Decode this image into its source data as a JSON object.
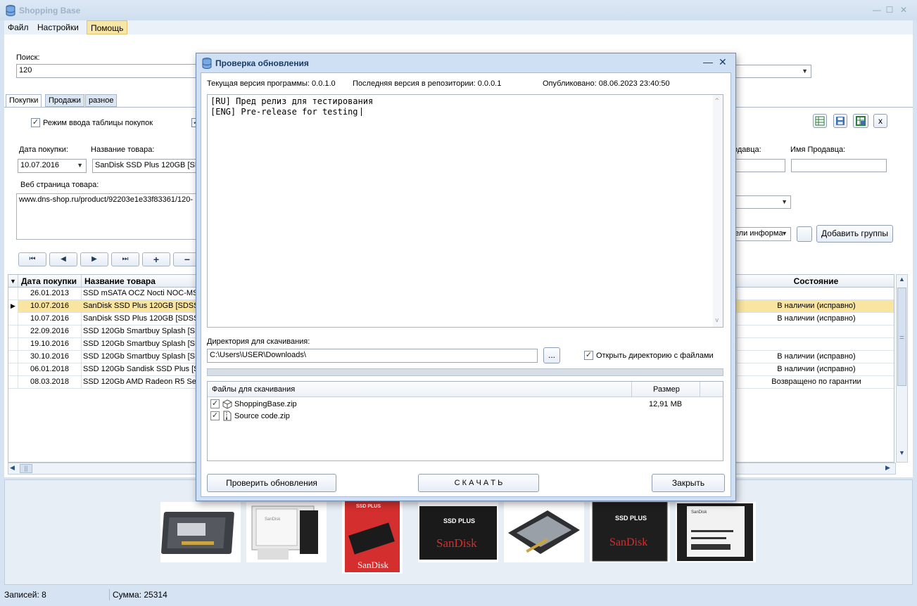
{
  "app": {
    "title": "Shopping Base"
  },
  "window_buttons": {
    "minimize": "—",
    "maximize": "☐",
    "close": "✕"
  },
  "menu": [
    "Файл",
    "Настройки",
    "Помощь"
  ],
  "search": {
    "label": "Поиск:",
    "value": "120"
  },
  "tabs": [
    "Покупки",
    "Продажи",
    "разное"
  ],
  "purchase_mode": {
    "label": "Режим ввода таблицы покупок",
    "checked": true
  },
  "fields": {
    "purchase_date_label": "Дата покупки:",
    "purchase_date_value": "10.07.2016",
    "product_name_label": "Название товара:",
    "product_name_value": "SanDisk SSD Plus 120GB [SDSS",
    "seller_label_partial": "одавца:",
    "seller_name_label": "Имя Продавца:",
    "web_page_label": "Веб страница товара:",
    "web_page_value": "www.dns-shop.ru/product/92203e1e33f83361/120-",
    "info_combo_value": "ели информа",
    "add_groups_button": "Добавить группы"
  },
  "toolbar_icons": [
    "excel-icon",
    "save-icon",
    "export-icon"
  ],
  "toolbar_close": "x",
  "nav_buttons": [
    "⏮",
    "◀",
    "▶",
    "⏭",
    "+",
    "−"
  ],
  "grid": {
    "headers": {
      "date": "Дата покупки",
      "name": "Название товара",
      "state": "Состояние"
    },
    "rows": [
      {
        "date": "26.01.2013",
        "name": "SSD mSATA OCZ Nocti NOC-MSAT",
        "state": "",
        "selected": false
      },
      {
        "date": "10.07.2016",
        "name": "SanDisk SSD Plus 120GB [SDSSDA",
        "state": "В наличии (исправно)",
        "selected": true
      },
      {
        "date": "10.07.2016",
        "name": "SanDisk SSD Plus 120GB [SDSSDA",
        "state": "В наличии (исправно)",
        "selected": false
      },
      {
        "date": "22.09.2016",
        "name": "SSD 120Gb Smartbuy Splash [SB1",
        "state": "",
        "selected": false
      },
      {
        "date": "19.10.2016",
        "name": "SSD 120Gb Smartbuy Splash [SB1",
        "state": "",
        "selected": false
      },
      {
        "date": "30.10.2016",
        "name": "SSD 120Gb Smartbuy Splash [SB1",
        "state": "В наличии (исправно)",
        "selected": false
      },
      {
        "date": "06.01.2018",
        "name": "SSD 120Gb Sandisk SSD Plus [SDS",
        "state": "В наличии (исправно)",
        "selected": false
      },
      {
        "date": "08.03.2018",
        "name": "SSD 120Gb AMD Radeon R5 Serie",
        "state": "Возвращено по гарантии",
        "selected": false
      }
    ]
  },
  "status": {
    "records": "Записей: 8",
    "sum": "Сумма: 25314"
  },
  "dialog": {
    "title": "Проверка обновления",
    "current_version": "Текущая версия программы: 0.0.1.0",
    "repo_version": "Последняя версия в репозитории: 0.0.0.1",
    "published": "Опубликовано: 08.06.2023 23:40:50",
    "notes_lines": [
      "[RU] Пред релиз для тестирования",
      "[ENG] Pre-release for testing"
    ],
    "dir_label": "Директория для скачивания:",
    "dir_value": "C:\\Users\\USER\\Downloads\\",
    "browse_button": "...",
    "open_dir": {
      "label": "Открыть директорию с файлами",
      "checked": true
    },
    "progress": 0,
    "files_header": {
      "name": "Файлы для скачивания",
      "size": "Размер"
    },
    "files": [
      {
        "name": "ShoppingBase.zip",
        "size": "12,91 MB",
        "checked": true,
        "icon": "package-icon"
      },
      {
        "name": "Source code.zip",
        "size": "",
        "checked": true,
        "icon": "zip-file-icon"
      }
    ],
    "buttons": {
      "check": "Проверить обновления",
      "download": "С К А Ч А Т Ь",
      "close": "Закрыть"
    }
  },
  "thumbnails": [
    {
      "name": "thumb-ssd-back",
      "brand": "",
      "label": ""
    },
    {
      "name": "thumb-ssd-box-open",
      "brand": "SanDisk",
      "label": ""
    },
    {
      "name": "thumb-sandisk-box",
      "brand": "SanDisk",
      "label": "SSD PLUS"
    },
    {
      "name": "thumb-sandisk-front-1",
      "brand": "SanDisk",
      "label": "SSD PLUS"
    },
    {
      "name": "thumb-ssd-angle",
      "brand": "",
      "label": ""
    },
    {
      "name": "thumb-sandisk-front-2",
      "brand": "SanDisk",
      "label": "SSD PLUS"
    },
    {
      "name": "thumb-ssd-label",
      "brand": "SanDisk",
      "label": ""
    }
  ]
}
